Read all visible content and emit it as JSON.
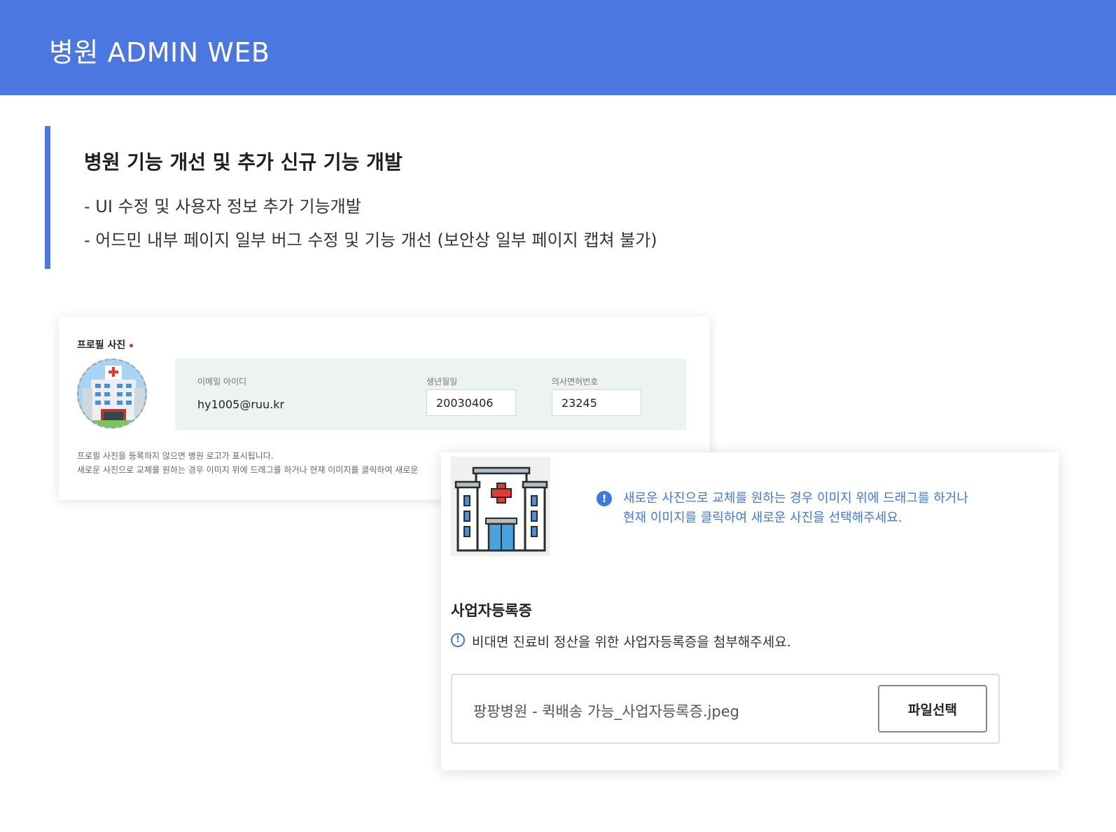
{
  "header": {
    "title": "병원 ADMIN WEB"
  },
  "section": {
    "title": "병원 기능 개선 및 추가 신규 기능 개발",
    "bullets": [
      "- UI 수정 및 사용자 정보 추가 기능개발",
      "- 어드민 내부 페이지 일부 버그 수정 및 기능 개선 (보안상 일부 페이지 캡쳐 불가)"
    ]
  },
  "profile_card": {
    "photo_label": "프로필 사진",
    "email_label": "이메일 아이디",
    "email_value": "hy1005@ruu.kr",
    "birth_label": "생년월일",
    "birth_value": "20030406",
    "license_label": "의사면허번호",
    "license_value": "23245",
    "notes": [
      "프로필 사진을 등록하지 않으면 병원 로고가 표시됩니다.",
      "새로운 사진으로 교체를 원하는 경우 이미지 위에 드래그를 하거나 현재 이미지를 클릭하여 새로운"
    ]
  },
  "business_card": {
    "info_icon": "!",
    "info_lines": [
      "새로운 사진으로 교체를 원하는 경우 이미지 위에 드래그를 하거나",
      "현재 이미지를 클릭하여 새로운 사진을 선택해주세요."
    ],
    "label": "사업자등록증",
    "note": "비대면 진료비 정산을 위한 사업자등록증을 첨부해주세요.",
    "file_name": "팡팡병원 - 퀵배송 가능_사업자등록증.jpeg",
    "file_button": "파일선택"
  },
  "colors": {
    "brand": "#4b78e0",
    "accent_blue": "#3d78e0",
    "required_dot": "#c0392b"
  },
  "icons": [
    "hospital-icon",
    "info-icon",
    "info-outline-icon"
  ]
}
